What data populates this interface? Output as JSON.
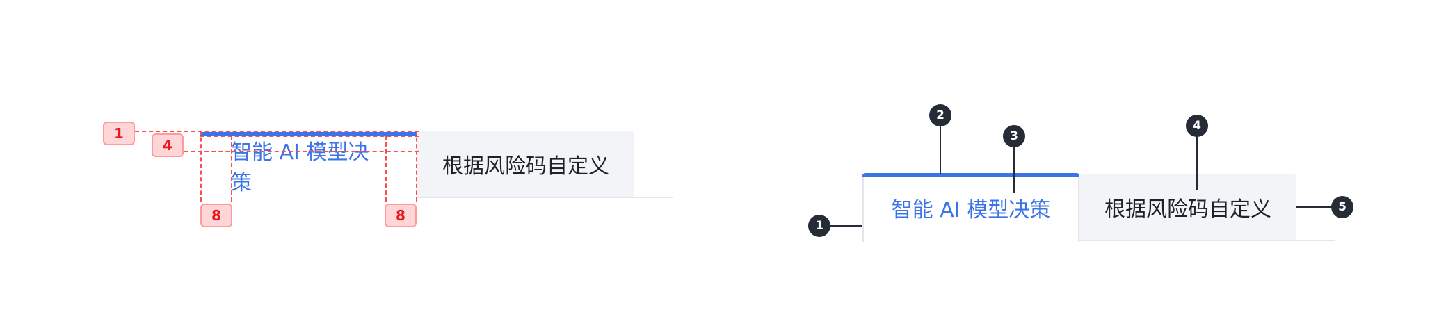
{
  "spec": {
    "active_tab_label": "智能 AI 模型决策",
    "inactive_tab_label": "根据风险码自定义",
    "measurements": [
      "1",
      "4",
      "8",
      "8"
    ]
  },
  "anatomy": {
    "active_tab_label": "智能 AI 模型决策",
    "inactive_tab_label": "根据风险码自定义",
    "markers": [
      "1",
      "2",
      "3",
      "4",
      "5"
    ]
  },
  "colors": {
    "accent": "#3b73e8",
    "inactive_bg": "#f2f4f8",
    "text": "#1f2329",
    "spec_red": "#ff4d4f",
    "marker_bg": "#262c36"
  }
}
